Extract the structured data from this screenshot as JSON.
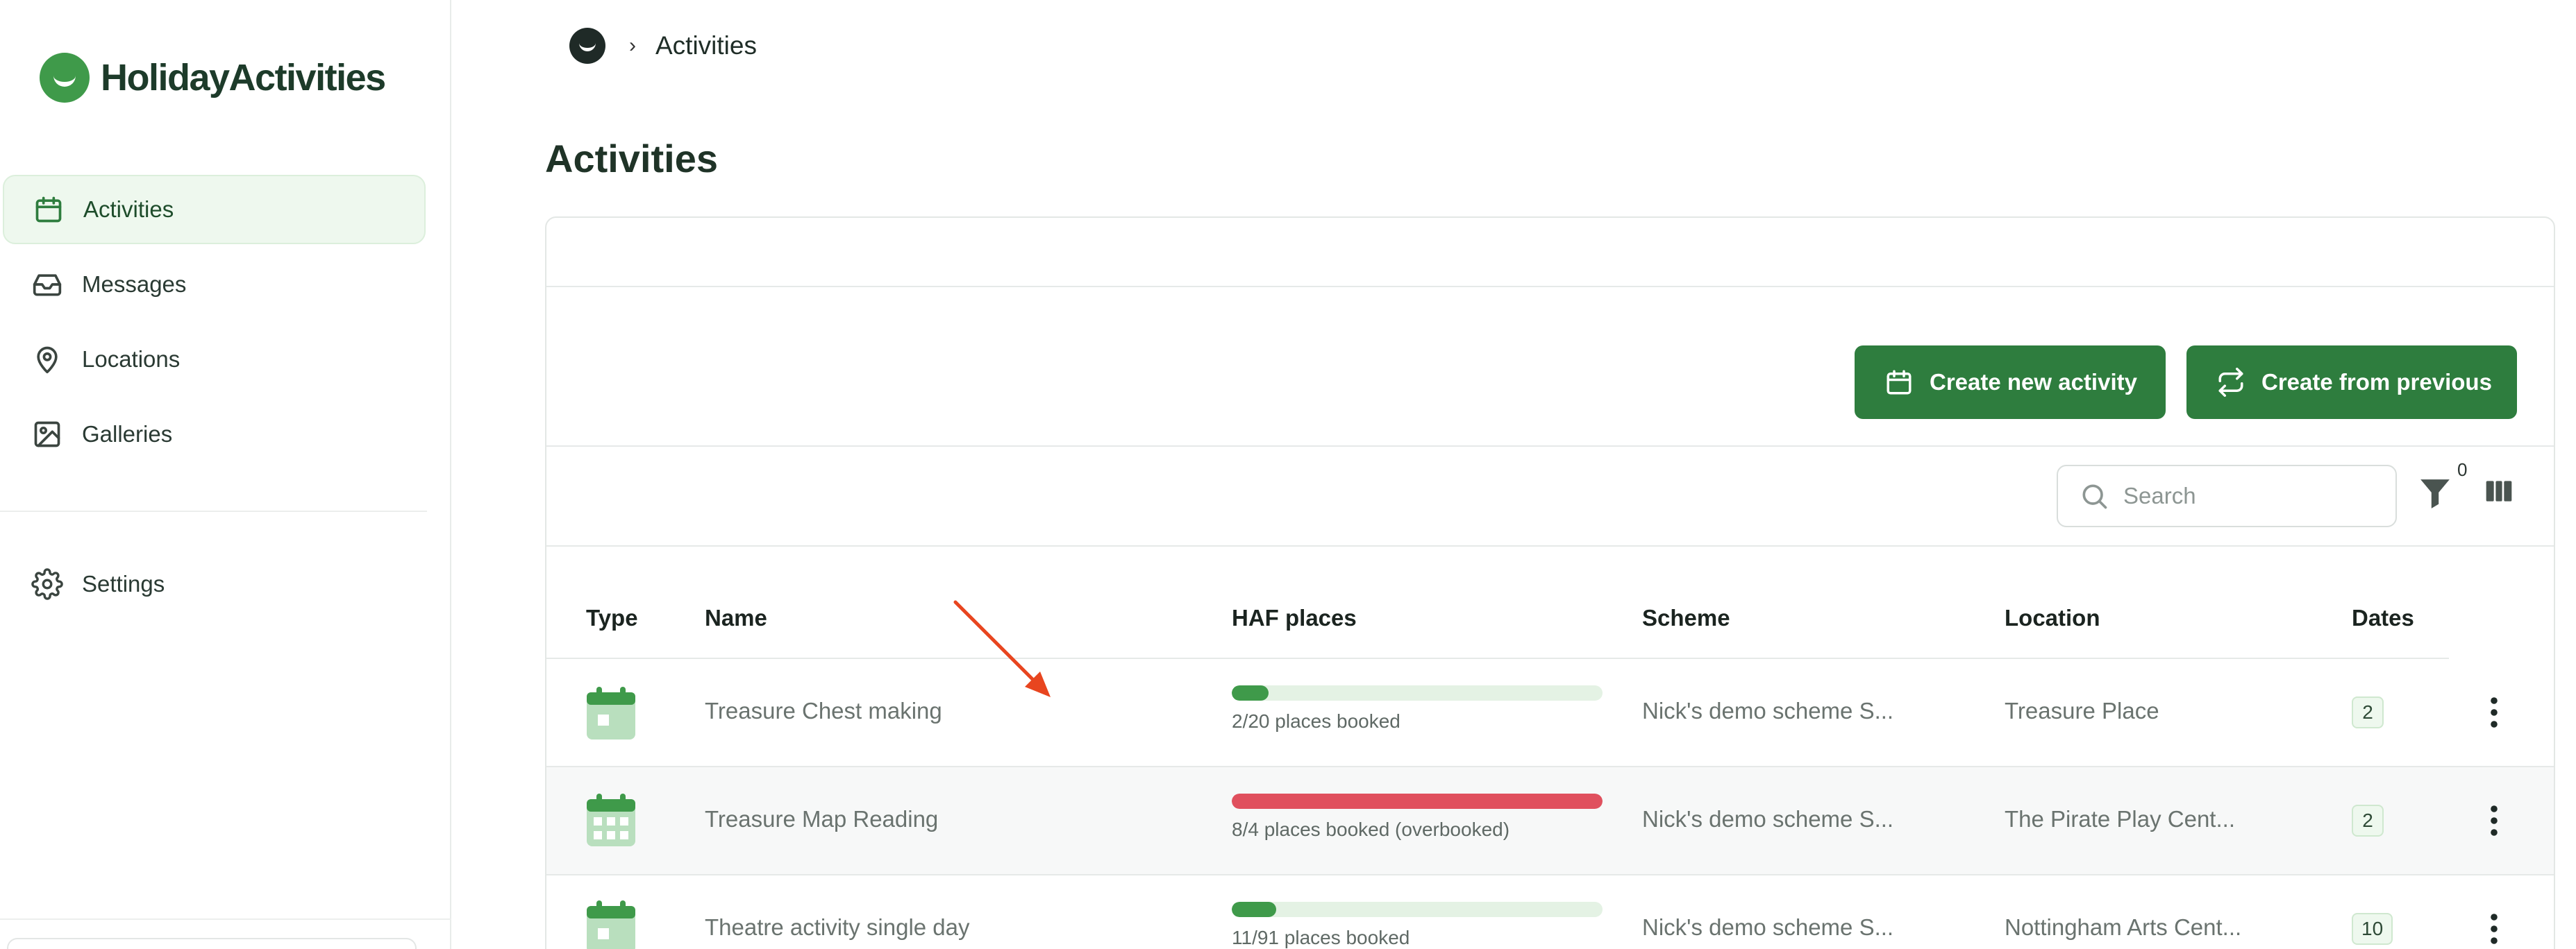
{
  "app": {
    "name": "HolidayActivities",
    "brand_color": "#3f9a4a",
    "button_color": "#2e7d3e"
  },
  "sidebar": {
    "items": [
      {
        "label": "Activities",
        "icon": "calendar-icon",
        "active": true
      },
      {
        "label": "Messages",
        "icon": "inbox-icon",
        "active": false
      },
      {
        "label": "Locations",
        "icon": "map-pin-icon",
        "active": false
      },
      {
        "label": "Galleries",
        "icon": "image-icon",
        "active": false
      }
    ],
    "settings": {
      "label": "Settings",
      "icon": "gear-icon"
    }
  },
  "breadcrumb": {
    "separator": "›",
    "current": "Activities"
  },
  "page": {
    "title": "Activities"
  },
  "toolbar": {
    "create_new_label": "Create new activity",
    "create_from_previous_label": "Create from previous",
    "search_placeholder": "Search",
    "filter_count": "0"
  },
  "table": {
    "headers": {
      "type": "Type",
      "name": "Name",
      "places": "HAF places",
      "scheme": "Scheme",
      "location": "Location",
      "dates": "Dates"
    },
    "rows": [
      {
        "type_icon": "calendar-single-day-icon",
        "name": "Treasure Chest making",
        "booked_fraction": 0.1,
        "overbooked": false,
        "places_text": "2/20 places booked",
        "scheme": "Nick's demo scheme S...",
        "location": "Treasure Place",
        "dates": "2"
      },
      {
        "type_icon": "calendar-multi-day-icon",
        "name": "Treasure Map Reading",
        "booked_fraction": 1.0,
        "overbooked": true,
        "places_text": "8/4 places booked (overbooked)",
        "scheme": "Nick's demo scheme S...",
        "location": "The Pirate Play Cent...",
        "dates": "2"
      },
      {
        "type_icon": "calendar-single-day-icon",
        "name": "Theatre activity single day",
        "booked_fraction": 0.12,
        "overbooked": false,
        "places_text": "11/91 places booked",
        "scheme": "Nick's demo scheme S...",
        "location": "Nottingham Arts Cent...",
        "dates": "10"
      }
    ]
  }
}
